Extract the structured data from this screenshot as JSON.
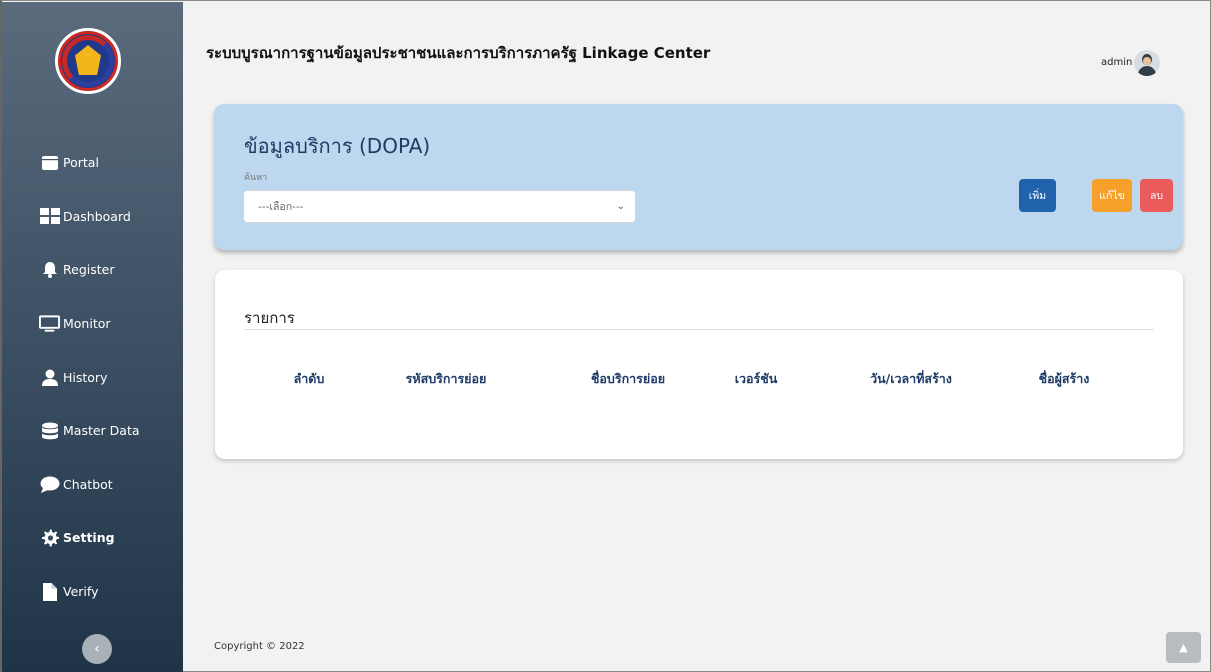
{
  "app": {
    "title": "ระบบบูรณาการฐานข้อมูลประชาชนและการบริการภาครัฐ Linkage Center",
    "logo_text": "กรมการพัฒนาชุมชน"
  },
  "user": {
    "name": "admin"
  },
  "sidebar": {
    "items": [
      {
        "label": "Portal",
        "icon": "window-icon"
      },
      {
        "label": "Dashboard",
        "icon": "grid-icon"
      },
      {
        "label": "Register",
        "icon": "bell-icon"
      },
      {
        "label": "Monitor",
        "icon": "monitor-icon"
      },
      {
        "label": "History",
        "icon": "user-icon"
      },
      {
        "label": "Master Data",
        "icon": "database-icon"
      },
      {
        "label": "Chatbot",
        "icon": "chat-bubble-icon"
      },
      {
        "label": "Setting",
        "icon": "gear-icon",
        "active": true
      },
      {
        "label": "Verify",
        "icon": "file-icon"
      }
    ],
    "collapse_icon": "chevron-left-icon"
  },
  "service_card": {
    "title": "ข้อมูลบริการ (DOPA)",
    "search_label": "ค้นหา",
    "select_value": "---เลือก---",
    "buttons": {
      "add": "เพิ่ม",
      "edit": "แก้ไข",
      "delete": "ลบ"
    }
  },
  "list_card": {
    "title": "รายการ",
    "columns": [
      "ลำดับ",
      "รหัสบริการย่อย",
      "ชื่อบริการย่อย",
      "เวอร์ชัน",
      "วัน/เวลาที่สร้าง",
      "ชื่อผู้สร้าง"
    ]
  },
  "footer": {
    "copyright": "Copyright © 2022"
  },
  "colors": {
    "sidebar_top": "#5b6b7c",
    "sidebar_bottom": "#203448",
    "card_blue": "#bcd7ee",
    "btn_add": "#1f63ad",
    "btn_edit": "#f5a02a",
    "btn_delete": "#ec5b5b",
    "heading": "#1f3a66"
  }
}
